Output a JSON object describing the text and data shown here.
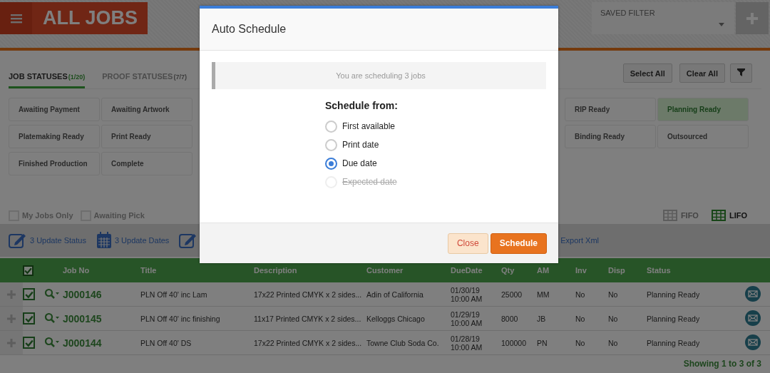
{
  "header": {
    "title": "ALL JOBS",
    "saved_filter": {
      "label": "SAVED FILTER"
    }
  },
  "status_tabs": [
    {
      "label": "JOB STATUSES",
      "count": "(1/20)",
      "selected": true
    },
    {
      "label": "PROOF STATUSES",
      "count": "(7/7)",
      "selected": false
    }
  ],
  "filter_buttons": [
    "Select All",
    "Clear All"
  ],
  "status_grid": {
    "rows": [
      {
        "left": [
          {
            "label": "Awaiting Payment",
            "selected": false
          },
          {
            "label": "Awaiting Artwork",
            "selected": false
          }
        ],
        "right": [
          {
            "label": "RIP Ready",
            "selected": false
          },
          {
            "label": "Planning Ready",
            "selected": true
          }
        ]
      },
      {
        "left": [
          {
            "label": "Platemaking Ready",
            "selected": false
          },
          {
            "label": "Print Ready",
            "selected": false
          }
        ],
        "right": [
          {
            "label": "Binding Ready",
            "selected": false
          },
          {
            "label": "Outsourced",
            "selected": false
          }
        ]
      },
      {
        "left": [
          {
            "label": "Finished Production",
            "selected": false
          },
          {
            "label": "Complete",
            "selected": false
          }
        ],
        "right": []
      }
    ]
  },
  "options": [
    {
      "label": "My Jobs Only",
      "checked": false
    },
    {
      "label": "Awaiting Pick",
      "checked": false
    }
  ],
  "order": [
    {
      "label": "FIFO",
      "selected": false
    },
    {
      "label": "LIFO",
      "selected": true
    }
  ],
  "actions": [
    {
      "label": "3 Update Status",
      "kind": "edit"
    },
    {
      "label": "3 Update Dates",
      "kind": "calendar"
    },
    {
      "kind": "edit"
    }
  ],
  "export": {
    "label": "Export Xml"
  },
  "table": {
    "all_checked": true,
    "columns": [
      "Job No",
      "Title",
      "Description",
      "Customer",
      "DueDate",
      "Qty",
      "AM",
      "Inv",
      "Disp",
      "Status"
    ],
    "rows": [
      {
        "checked": true,
        "job_no": "J000146",
        "title": "PLN Off 40' inc Lam",
        "description": "17x22  Printed CMYK x 2 sides...",
        "customer": "Adin of California",
        "due_date": "01/30/19",
        "due_time": "10:00 AM",
        "qty": "25000",
        "am": "MM",
        "inv": "No",
        "disp": "No",
        "status": "Planning Ready"
      },
      {
        "checked": true,
        "job_no": "J000145",
        "title": "PLN Off 40' inc finishing",
        "description": "11x17  Printed CMYK x 2 sides...",
        "customer": "Kelloggs Chicago",
        "due_date": "01/29/19",
        "due_time": "10:00 AM",
        "qty": "8000",
        "am": "JB",
        "inv": "No",
        "disp": "No",
        "status": "Planning Ready"
      },
      {
        "checked": true,
        "job_no": "J000144",
        "title": "PLN Off 40' DS",
        "description": "17x22  Printed CMYK x 2 sides...",
        "customer": "Towne Club Soda Co.",
        "due_date": "01/28/19",
        "due_time": "10:00 AM",
        "qty": "100000",
        "am": "PN",
        "inv": "No",
        "disp": "No",
        "status": "Planning Ready"
      }
    ]
  },
  "footer": "Showing 1 to 3 of 3",
  "dialog": {
    "title": "Auto Schedule",
    "notice": "You are scheduling 3 jobs",
    "prompt": "Schedule from:",
    "options": [
      {
        "label": "First available",
        "selected": false,
        "disabled": false
      },
      {
        "label": "Print date",
        "selected": false,
        "disabled": false
      },
      {
        "label": "Due date",
        "selected": true,
        "disabled": false
      },
      {
        "label": "Expected date",
        "selected": false,
        "disabled": true
      }
    ],
    "buttons": [
      {
        "label": "Close",
        "kind": "secondary"
      },
      {
        "label": "Schedule",
        "kind": "primary"
      }
    ]
  }
}
